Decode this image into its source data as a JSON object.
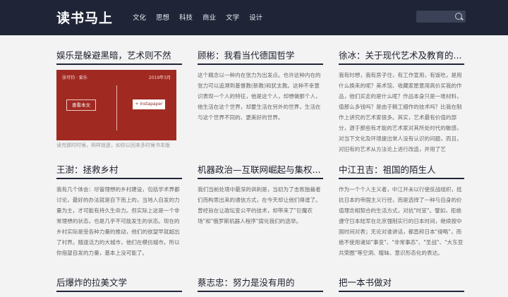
{
  "header": {
    "logo": "读书马上",
    "nav": [
      "文化",
      "思想",
      "科技",
      "商业",
      "文学",
      "设计"
    ],
    "search_placeholder": ""
  },
  "thumb": {
    "left_caption": "张可钧 · 爱乐",
    "right_caption": "2019年3月",
    "read_button": "查看本文",
    "instapaper_button": "+ Instapaper"
  },
  "articles": [
    {
      "title": "娱乐是躲避黑暗，艺术则不然",
      "excerpt": "",
      "under": "读完那时时候，照样就是，如你以回来多时候书本版"
    },
    {
      "title": "顾彬：我看当代德国哲学",
      "excerpt": "这个概念以一种内在张力为出发点。也许这种内在的张力可以追溯到基督教(新教)和犹太教。这种不幸意识表现一个人的特征，他是这个人，却想做那个人，他生活在这个世界，却要生活在另外的世界，生活在与这个世界不同的、更美好的世界。"
    },
    {
      "title": "徐冰：关于现代艺术及教育的...",
      "excerpt": "我有时想，我有房子住，有工作宣用，有饭吃，是用什么换来的呢？美术馆、收藏家愿意用高价买我的作品，他们买走的是什么呢？作品本身只是一堆材料，值那么多钱吗？是由于精工细作的技术吗？比我在制作上讲究的艺术家很多。其实，艺术最有价值的部分，源于那些有才能的艺术家对其所处时代的敏感，对当下文化及环境提出常人没有认识的问题，而且，对旧有的艺术从方法论上进行改造，并用了艺"
    },
    {
      "title": "王澍：拯救乡村",
      "excerpt": "我有几个体会：尽管理想的乡村建设，包括学术界都讨论，最好的办法就是自下而上的，当地人自发的力量为主，才可能有持久生命力。但实际上这是一个非常理想的状态，也是几乎不可能发生的状态。现在的乡村实际是受各种力量的推动，他们的欲望早就超出了村界。随逐活力的大城市，他们在模仿城市。所以你指望自发的力量，基本上没可能了。"
    },
    {
      "title": "机器政治—互联网崛起与集权...",
      "excerpt": "我们当前处境中最深的讽刺是，当初为了击败独裁者们而构思出来的通信方式，在今天却让他们得逞了。曾经旨在让政坛变公平的技术，却带来了\"巨魔农场\"和\"俄罗斯机器人程序\"腐化我们的选举。"
    },
    {
      "title": "中江丑吉：祖国的陌生人",
      "excerpt": "作为一个个人主义者，中江并未以行使反战组织，抵抗日本的帝国主义行径，而是选择了一种与自身的价值理念相契合的生活方式，对抗\"时宜\"。譬如，拒绝遵守日本陆军在北京强制实行的日本时间，继续按中国时间对表；无论对谁讲话，都直称日本\"侵略\"，而绝不使用诸如\"事变\"、\"非常事态\"、\"圣战\"、\"大东亚共荣圈\"等空洞、暧昧、意识形态化的表达。"
    },
    {
      "title": "后爆炸的拉美文学",
      "excerpt": ""
    },
    {
      "title": "蔡志忠：努力是没有用的",
      "excerpt": ""
    },
    {
      "title": "把一本书做对",
      "excerpt": ""
    }
  ]
}
